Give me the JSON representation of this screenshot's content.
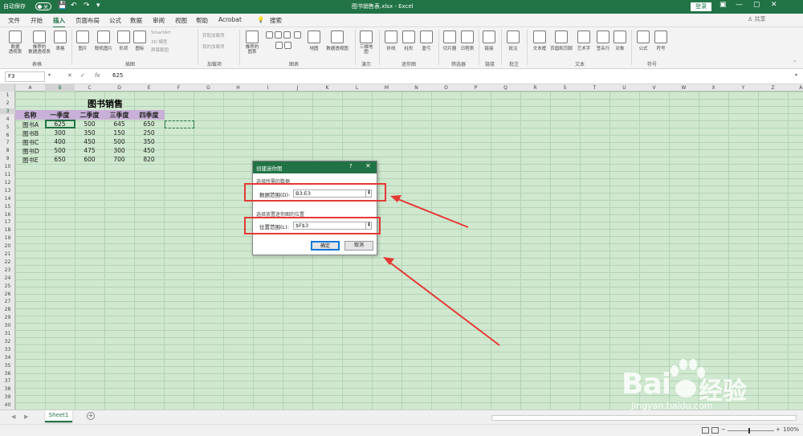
{
  "titlebar": {
    "autosave_label": "自动保存",
    "autosave_state": "关",
    "document_title": "图书销售表.xlsx  -  Excel",
    "login_label": "登录"
  },
  "menu": {
    "tabs": [
      "文件",
      "开始",
      "插入",
      "页面布局",
      "公式",
      "数据",
      "审阅",
      "视图",
      "帮助",
      "Acrobat"
    ],
    "active_tab": "插入",
    "search_label": "搜索",
    "share_label": "共享"
  },
  "ribbon": {
    "items": [
      {
        "label": "数据\n透视表",
        "icon": "pivot-table-icon"
      },
      {
        "label": "推荐的\n数据透视表",
        "icon": "recommended-pivot-icon"
      },
      {
        "label": "表格",
        "icon": "table-icon"
      },
      {
        "label": "图片",
        "icon": "picture-icon"
      },
      {
        "label": "联机图片",
        "icon": "online-picture-icon"
      },
      {
        "label": "形状",
        "icon": "shapes-icon"
      },
      {
        "label": "图标",
        "icon": "icons-icon"
      },
      {
        "label": "推荐的\n图表",
        "icon": "recommended-chart-icon"
      },
      {
        "label": "地图",
        "icon": "map-icon"
      },
      {
        "label": "数据透视图",
        "icon": "pivot-chart-icon"
      },
      {
        "label": "三维地\n图",
        "icon": "3d-map-icon"
      },
      {
        "label": "折线",
        "icon": "sparkline-line-icon"
      },
      {
        "label": "柱形",
        "icon": "sparkline-column-icon"
      },
      {
        "label": "盈亏",
        "icon": "sparkline-winloss-icon"
      },
      {
        "label": "切片器",
        "icon": "slicer-icon"
      },
      {
        "label": "日程表",
        "icon": "timeline-icon"
      },
      {
        "label": "链接",
        "icon": "link-icon"
      },
      {
        "label": "批注",
        "icon": "comment-icon"
      },
      {
        "label": "文本框",
        "icon": "textbox-icon"
      },
      {
        "label": "页眉和页脚",
        "icon": "header-footer-icon"
      },
      {
        "label": "艺术字",
        "icon": "wordart-icon"
      },
      {
        "label": "签名行",
        "icon": "signature-icon"
      },
      {
        "label": "对象",
        "icon": "object-icon"
      },
      {
        "label": "公式",
        "icon": "equation-icon"
      },
      {
        "label": "符号",
        "icon": "symbol-icon"
      }
    ],
    "side_labels": [
      "SmartArt",
      "3D 模型",
      "屏幕截图",
      "获取加载项",
      "我的加载项"
    ],
    "groups": [
      "表格",
      "插图",
      "加载项",
      "图表",
      "演示",
      "迷你图",
      "筛选器",
      "链接",
      "批注",
      "文本",
      "符号"
    ]
  },
  "formula_bar": {
    "name_box": "F3",
    "value": "625",
    "fx_label": "fx"
  },
  "columns": [
    "A",
    "B",
    "C",
    "D",
    "E",
    "F",
    "G",
    "H",
    "I",
    "J",
    "K",
    "L",
    "M",
    "N",
    "O",
    "P",
    "Q",
    "R",
    "S",
    "T",
    "U",
    "V",
    "W",
    "X",
    "Y",
    "Z",
    "AA"
  ],
  "selected_column": "B",
  "row_count": 40,
  "selected_row": "3",
  "table": {
    "title": "图书销售",
    "headers": [
      "名称",
      "一季度",
      "二季度",
      "三季度",
      "四季度"
    ],
    "rows": [
      {
        "name": "图书A",
        "values": [
          "625",
          "500",
          "645",
          "650"
        ]
      },
      {
        "name": "图书B",
        "values": [
          "300",
          "350",
          "150",
          "250"
        ]
      },
      {
        "name": "图书C",
        "values": [
          "400",
          "450",
          "500",
          "350"
        ]
      },
      {
        "name": "图书D",
        "values": [
          "500",
          "475",
          "300",
          "450"
        ]
      },
      {
        "name": "图书E",
        "values": [
          "650",
          "600",
          "700",
          "820"
        ]
      }
    ]
  },
  "dialog": {
    "title": "创建迷你图",
    "help": "?",
    "close": "✕",
    "section_data": "选择所需的数据",
    "data_range_label": "数据范围(D):",
    "data_range_value": "B3:E3",
    "section_location": "选择放置迷你图的位置",
    "location_label": "位置范围(L):",
    "location_value": "$F$3",
    "ok_label": "确定",
    "cancel_label": "取消"
  },
  "sheets": {
    "tabs": [
      "Sheet1"
    ],
    "active": "Sheet1"
  },
  "status": {
    "zoom_minus": "−",
    "zoom_plus": "+",
    "zoom_percent": "100%"
  },
  "watermark": {
    "brand": "Bai",
    "brand_cn": "经验",
    "url": "jingyan.baidu.com"
  },
  "colors": {
    "excel_green": "#217346",
    "grid_bg": "#cfe8cf",
    "header_purple": "#c9b0d8",
    "annotation_red": "#e53935"
  }
}
